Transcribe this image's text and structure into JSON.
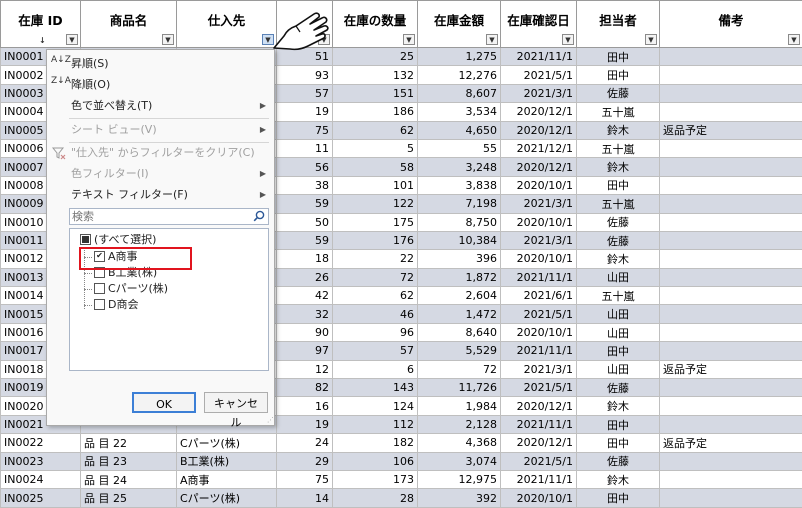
{
  "columns": [
    {
      "label": "在庫 ID",
      "sort_mark": "↓"
    },
    {
      "label": "商品名"
    },
    {
      "label": "仕入先",
      "active": true
    },
    {
      "label": ""
    },
    {
      "label": "在庫の数量"
    },
    {
      "label": "在庫金額"
    },
    {
      "label": "在庫確認日"
    },
    {
      "label": "担当者"
    },
    {
      "label": "備考"
    }
  ],
  "filter_glyph": "▼",
  "rows": [
    [
      "IN0001",
      "",
      "",
      "51",
      "25",
      "1,275",
      "2021/11/1",
      "田中",
      ""
    ],
    [
      "IN0002",
      "",
      "",
      "93",
      "132",
      "12,276",
      "2021/5/1",
      "田中",
      ""
    ],
    [
      "IN0003",
      "",
      "",
      "57",
      "151",
      "8,607",
      "2021/3/1",
      "佐藤",
      ""
    ],
    [
      "IN0004",
      "",
      "",
      "19",
      "186",
      "3,534",
      "2020/12/1",
      "五十嵐",
      ""
    ],
    [
      "IN0005",
      "",
      "",
      "75",
      "62",
      "4,650",
      "2020/12/1",
      "鈴木",
      "返品予定"
    ],
    [
      "IN0006",
      "",
      "",
      "11",
      "5",
      "55",
      "2021/12/1",
      "五十嵐",
      ""
    ],
    [
      "IN0007",
      "",
      "",
      "56",
      "58",
      "3,248",
      "2020/12/1",
      "鈴木",
      ""
    ],
    [
      "IN0008",
      "",
      "",
      "38",
      "101",
      "3,838",
      "2020/10/1",
      "田中",
      ""
    ],
    [
      "IN0009",
      "",
      "",
      "59",
      "122",
      "7,198",
      "2021/3/1",
      "五十嵐",
      ""
    ],
    [
      "IN0010",
      "",
      "",
      "50",
      "175",
      "8,750",
      "2020/10/1",
      "佐藤",
      ""
    ],
    [
      "IN0011",
      "",
      "",
      "59",
      "176",
      "10,384",
      "2021/3/1",
      "佐藤",
      ""
    ],
    [
      "IN0012",
      "",
      "",
      "18",
      "22",
      "396",
      "2020/10/1",
      "鈴木",
      ""
    ],
    [
      "IN0013",
      "",
      "",
      "26",
      "72",
      "1,872",
      "2021/11/1",
      "山田",
      ""
    ],
    [
      "IN0014",
      "",
      "",
      "42",
      "62",
      "2,604",
      "2021/6/1",
      "五十嵐",
      ""
    ],
    [
      "IN0015",
      "",
      "",
      "32",
      "46",
      "1,472",
      "2021/5/1",
      "山田",
      ""
    ],
    [
      "IN0016",
      "",
      "",
      "90",
      "96",
      "8,640",
      "2020/10/1",
      "山田",
      ""
    ],
    [
      "IN0017",
      "",
      "",
      "97",
      "57",
      "5,529",
      "2021/11/1",
      "田中",
      ""
    ],
    [
      "IN0018",
      "",
      "",
      "12",
      "6",
      "72",
      "2021/3/1",
      "山田",
      "返品予定"
    ],
    [
      "IN0019",
      "",
      "",
      "82",
      "143",
      "11,726",
      "2021/5/1",
      "佐藤",
      ""
    ],
    [
      "IN0020",
      "",
      "",
      "16",
      "124",
      "1,984",
      "2020/12/1",
      "鈴木",
      ""
    ],
    [
      "IN0021",
      "",
      "",
      "19",
      "112",
      "2,128",
      "2021/11/1",
      "田中",
      ""
    ],
    [
      "IN0022",
      "品 目 22",
      "Cパーツ(株)",
      "24",
      "182",
      "4,368",
      "2020/12/1",
      "田中",
      "返品予定"
    ],
    [
      "IN0023",
      "品 目 23",
      "B工業(株)",
      "29",
      "106",
      "3,074",
      "2021/5/1",
      "佐藤",
      ""
    ],
    [
      "IN0024",
      "品 目 24",
      "A商事",
      "75",
      "173",
      "12,975",
      "2021/11/1",
      "鈴木",
      ""
    ],
    [
      "IN0025",
      "品 目 25",
      "Cパーツ(株)",
      "14",
      "28",
      "392",
      "2020/10/1",
      "田中",
      ""
    ]
  ],
  "menu": {
    "sort_asc_icon": "A↓Z",
    "sort_asc": "昇順(S)",
    "sort_desc_icon": "Z↓A",
    "sort_desc": "降順(O)",
    "sort_by_color": "色で並べ替え(T)",
    "sheet_view": "シート ビュー(V)",
    "clear_filter": "\"仕入先\" からフィルターをクリア(C)",
    "color_filter": "色フィルター(I)",
    "text_filter": "テキスト フィルター(F)",
    "search_placeholder": "検索",
    "select_all": "(すべて選択)",
    "items": [
      {
        "label": "A商事",
        "checked": true
      },
      {
        "label": "B工業(株)",
        "checked": false
      },
      {
        "label": "Cパーツ(株)",
        "checked": false
      },
      {
        "label": "D商会",
        "checked": false
      }
    ],
    "check_glyph": "✔",
    "arrow": "▶",
    "ok": "OK",
    "cancel": "キャンセル",
    "grip": "⋰"
  },
  "colors": {
    "band": "#d5d9e3",
    "highlight_box": "#e1141e",
    "ok_border": "#3c7fd6"
  }
}
